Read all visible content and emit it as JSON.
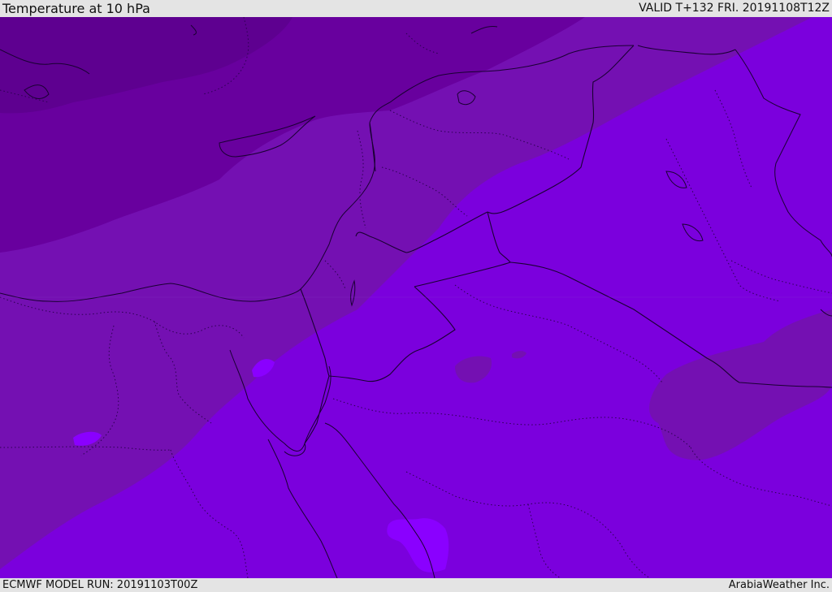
{
  "header": {
    "title": "Temperature at 10 hPa",
    "valid": "VALID T+132 FRI. 20191108T12Z"
  },
  "footer": {
    "model_run": "ECMWF MODEL RUN: 20191103T00Z",
    "credit": "ArabiaWeather Inc."
  },
  "map": {
    "colors": {
      "band_coldest": "#5e0090",
      "band_cold": "#68009e",
      "band_mid": "#7410b2",
      "band_base": "#7b00dd",
      "band_warm": "#8a00ff",
      "land_lines": "#1a0033",
      "border_dotted": "#2b0050"
    }
  }
}
